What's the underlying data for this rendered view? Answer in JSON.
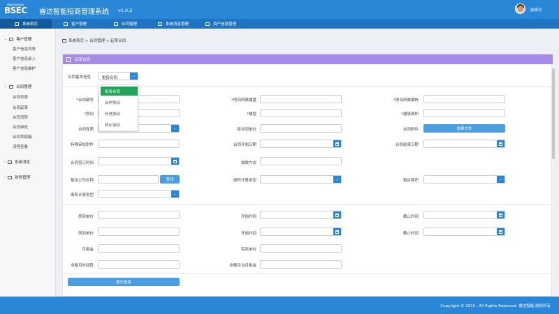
{
  "header": {
    "logo_small": "智能商业招商运营",
    "logo_text": "BSEC",
    "title": "睿达智能招商管理系统",
    "version": "v1.0.2",
    "username": "张妍灵"
  },
  "nav": [
    "系统首页",
    "客户管理",
    "合同管理",
    "系统消息管理",
    "资产信息管理"
  ],
  "sidebar": {
    "groups": [
      {
        "label": "客户管理",
        "items": [
          "客户信息列表",
          "客户信息录入",
          "客户信息维护"
        ]
      },
      {
        "label": "合同管理",
        "items": [
          "合同列表",
          "合同起草",
          "合同流转",
          "合同审批",
          "合同草稿箱",
          "流程查看"
        ]
      },
      {
        "label": "系统消息",
        "items": []
      },
      {
        "label": "财务管理",
        "items": []
      }
    ]
  },
  "breadcrumb": "系统首页 > 合同管理 > 起草合同",
  "panel_title": "起草合同",
  "form": {
    "basic_info_label": "合同基本信息",
    "basic_info_value": "租赁合同",
    "dropdown_options": [
      "租赁合同",
      "合作协议",
      "补充协议",
      "终止协议"
    ],
    "labels": {
      "contract_no": "*合同编号",
      "room_building": "*房间所属楼盘",
      "room_floor": "*房间所属楼栋",
      "room": "*房间",
      "floor": "*楼层",
      "building_area": "*建筑面积",
      "contract_nature": "合同性质",
      "original_unit_price": "原合同单价",
      "attachment": "合同附件",
      "special_attachment": "特殊审批附件",
      "start_date": "合同开始日期",
      "end_date": "合同结束日期",
      "sign_time": "合同签订时间",
      "payment_method": "收款方式",
      "lease_company": "租赁公司名称",
      "area_calc_type": "面积计算类型",
      "lease_area": "租赁面积",
      "area_calc_type2": "面积计算类型",
      "room_price_1": "房间单价",
      "start_time_1": "开始时间",
      "end_time_1": "截止时间",
      "room_price_2": "房间单价",
      "start_time_2": "开始时间",
      "end_time_2": "截止时间",
      "monthly_rent": "月租金",
      "actual_price": "实际单价",
      "partial_month": "非整月时间段",
      "partial_month_rent": "非整月当月租金"
    },
    "choose_file": "选择文件",
    "search_button": "查找",
    "submit_button": "提交信息"
  },
  "footer": "Copyright © 2015 . All Rights Reserved. 睿达智能 版权所有",
  "colors": {
    "header": "#2a87d7",
    "nav": "#1f74c1",
    "panel_head": "#a78ae6",
    "accent": "#2a87d7",
    "selected_option": "#21a35b"
  }
}
